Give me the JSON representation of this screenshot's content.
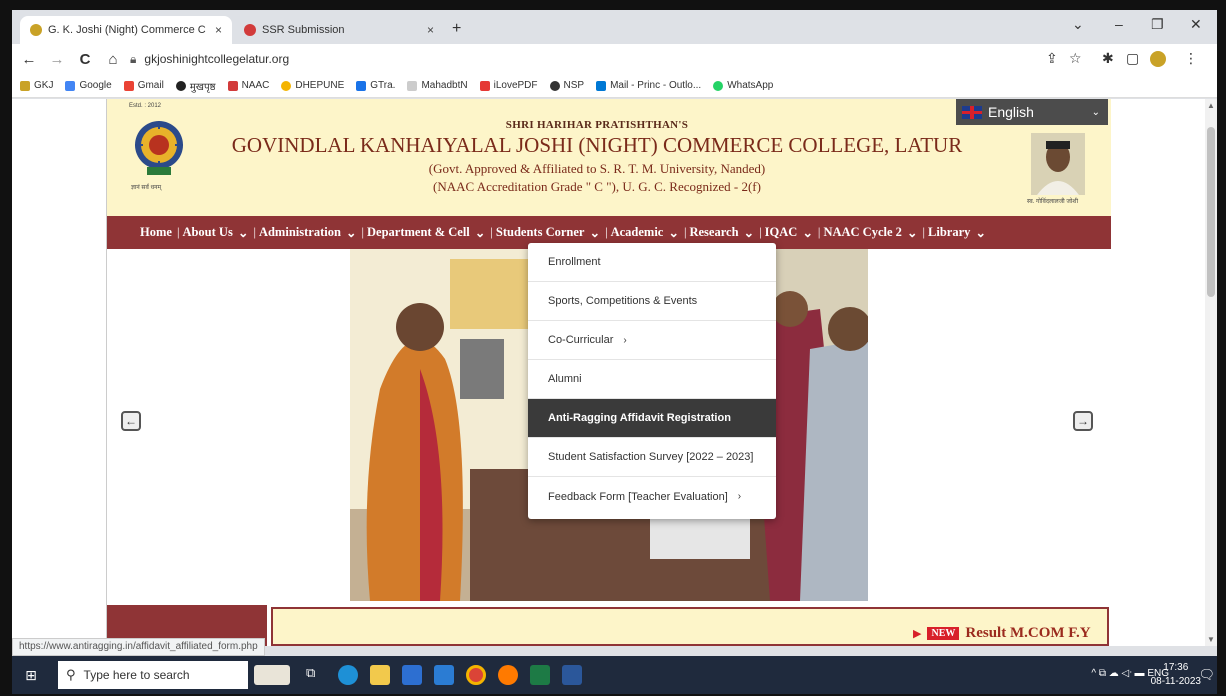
{
  "browser": {
    "tabs": [
      {
        "title": "G. K. Joshi (Night) Commerce C",
        "active": true,
        "close": "×"
      },
      {
        "title": "SSR Submission",
        "active": false,
        "close": "×"
      }
    ],
    "new_tab": "+",
    "window_controls": {
      "list": "⌄",
      "minimize": "–",
      "restore": "❐",
      "close": "✕"
    },
    "nav": {
      "back": "←",
      "forward": "→",
      "reload": "C",
      "home": "⌂"
    },
    "url": "gkjoshinightcollegelatur.org",
    "toolbar_icons": {
      "share": "⇪",
      "star": "☆",
      "ext": "✱",
      "sidebar": "▢",
      "menu": "⋮"
    },
    "bookmarks": [
      "GKJ",
      "Google",
      "Gmail",
      "मुखपृष्ठ",
      "NAAC",
      "DHEPUNE",
      "GTra.",
      "MahadbtN",
      "iLovePDF",
      "NSP",
      "Mail - Princ - Outlo...",
      "WhatsApp"
    ],
    "status_url": "https://www.antiragging.in/affidavit_affiliated_form.php"
  },
  "site": {
    "est": "Estd. : 2012",
    "logo_caption": "ज्ञानं सर्वं धनम्",
    "trust": "SHRI HARIHAR PRATISHTHAN'S",
    "college": "GOVINDLAL KANHAIYALAL JOSHI (NIGHT) COMMERCE COLLEGE, LATUR",
    "affiliation": "(Govt. Approved & Affiliated to S. R. T. M. University, Nanded)",
    "accreditation": "(NAAC Accreditation Grade \" C \"), U. G. C. Recognized - 2(f)",
    "portrait_caption": "स्व. गोविंदलालजी जोशी",
    "language": "English",
    "nav": [
      {
        "label": "Home",
        "caret": false
      },
      {
        "label": "About Us",
        "caret": true
      },
      {
        "label": "Administration",
        "caret": true
      },
      {
        "label": "Department & Cell",
        "caret": true
      },
      {
        "label": "Students Corner",
        "caret": true
      },
      {
        "label": "Academic",
        "caret": true
      },
      {
        "label": "Research",
        "caret": true
      },
      {
        "label": "IQAC",
        "caret": true
      },
      {
        "label": "NAAC Cycle 2",
        "caret": true
      },
      {
        "label": "Library",
        "caret": true
      }
    ],
    "dropdown": [
      {
        "label": "Enrollment",
        "sub": false,
        "active": false
      },
      {
        "label": "Sports, Competitions & Events",
        "sub": false,
        "active": false
      },
      {
        "label": "Co-Curricular",
        "sub": true,
        "active": false
      },
      {
        "label": "Alumni",
        "sub": false,
        "active": false
      },
      {
        "label": "Anti-Ragging Affidavit Registration",
        "sub": false,
        "active": true
      },
      {
        "label": "Student Satisfaction Survey [2022 – 2023]",
        "sub": false,
        "active": false
      },
      {
        "label": "Feedback Form [Teacher Evaluation]",
        "sub": true,
        "active": false
      }
    ],
    "slider_prev": "←",
    "slider_next": "→",
    "news_badge": "NEW",
    "news_text": "Result M.COM F.Y"
  },
  "taskbar": {
    "search_placeholder": "Type here to search",
    "tray": "^ ⧉ ☁ ◁ᐧ ▬ ENG",
    "time": "17:36",
    "date": "08-11-2023"
  },
  "colors": {
    "maroon": "#8f3436",
    "cream": "#fdf5c9",
    "title": "#7a2a1a"
  }
}
